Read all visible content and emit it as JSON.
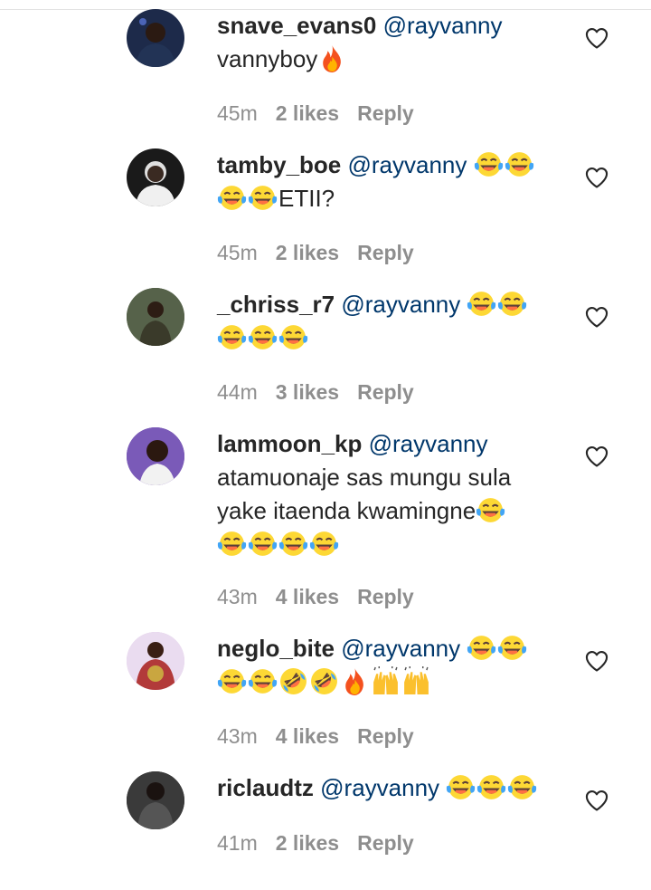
{
  "comments": [
    {
      "username": "snave_evans0",
      "mention": "@rayvanny",
      "text_pre": "",
      "lines": [
        {
          "text": "vannyboy",
          "emoji": [
            "fire"
          ]
        }
      ],
      "time": "45m",
      "likes": "2 likes",
      "reply": "Reply",
      "avatar_color": "#1d2a4a"
    },
    {
      "username": "tamby_boe",
      "mention": "@rayvanny",
      "mention_emoji": [
        "joy",
        "joy"
      ],
      "lines": [
        {
          "pre_emoji": [
            "joy",
            "joy"
          ],
          "text": "ETII?"
        }
      ],
      "time": "45m",
      "likes": "2 likes",
      "reply": "Reply",
      "avatar_color": "#1a1a1a"
    },
    {
      "username": "_chriss_r7",
      "mention": "@rayvanny",
      "mention_emoji": [
        "joy",
        "joy"
      ],
      "lines": [
        {
          "pre_emoji": [
            "joy",
            "joy",
            "joy"
          ],
          "text": ""
        }
      ],
      "time": "44m",
      "likes": "3 likes",
      "reply": "Reply",
      "avatar_color": "#4a5a3a"
    },
    {
      "username": "lammoon_kp",
      "mention": "@rayvanny",
      "lines": [
        {
          "text": "atamuonaje sas mungu sula"
        },
        {
          "text": "yake itaenda kwamingne",
          "emoji": [
            "joy"
          ]
        },
        {
          "pre_emoji": [
            "joy",
            "joy",
            "joy",
            "joy"
          ],
          "text": ""
        }
      ],
      "time": "43m",
      "likes": "4 likes",
      "reply": "Reply",
      "avatar_color": "#6a4aa0"
    },
    {
      "username": "neglo_bite",
      "mention": "@rayvanny",
      "mention_emoji": [
        "joy",
        "joy"
      ],
      "lines": [
        {
          "pre_emoji": [
            "joy",
            "joy",
            "rofl",
            "rofl",
            "fire",
            "raised",
            "raised"
          ],
          "text": ""
        }
      ],
      "time": "43m",
      "likes": "4 likes",
      "reply": "Reply",
      "avatar_color": "#d8c0e0"
    },
    {
      "username": "riclaudtz",
      "mention": "@rayvanny",
      "mention_emoji": [
        "joy",
        "joy",
        "joy"
      ],
      "lines": [],
      "time": "41m",
      "likes": "2 likes",
      "reply": "Reply",
      "avatar_color": "#2a2a2a"
    }
  ],
  "icons": {
    "heart": "heart-outline-icon",
    "emoji_joy": "face-with-tears-of-joy",
    "emoji_rofl": "rolling-on-floor-laughing",
    "emoji_fire": "fire",
    "emoji_raised": "raising-hands"
  },
  "colors": {
    "text": "#262626",
    "mention": "#00376b",
    "meta": "#8e8e8e"
  }
}
